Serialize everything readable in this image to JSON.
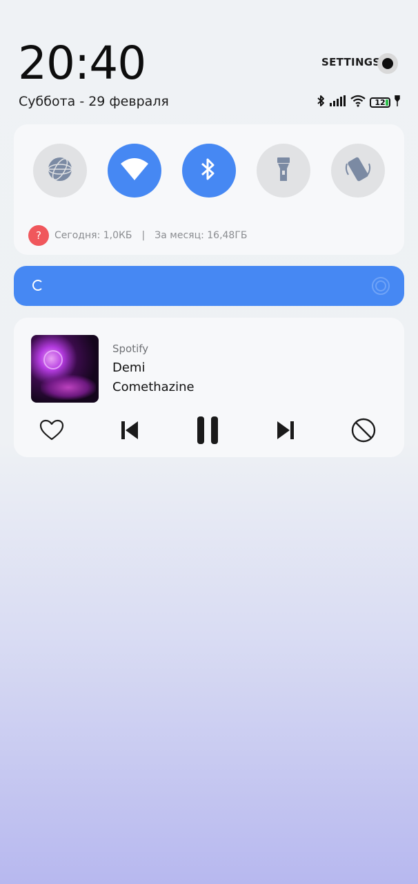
{
  "header": {
    "time": "20:40",
    "date": "Суббота - 29 февраля",
    "settings_label": "SETTINGS",
    "battery": "12"
  },
  "quick_settings": {
    "tiles": [
      {
        "name": "globe",
        "active": false
      },
      {
        "name": "wifi",
        "active": true
      },
      {
        "name": "bluetooth",
        "active": true
      },
      {
        "name": "flashlight",
        "active": false
      },
      {
        "name": "auto-rotate",
        "active": false
      }
    ],
    "usage_today": "Сегодня: 1,0КБ",
    "usage_separator": "|",
    "usage_month": "За месяц: 16,48ГБ"
  },
  "media": {
    "app": "Spotify",
    "title": "Demi",
    "artist": "Comethazine"
  },
  "colors": {
    "accent": "#4688f3",
    "tile_off": "#e1e2e4",
    "warning": "#f0575c"
  }
}
